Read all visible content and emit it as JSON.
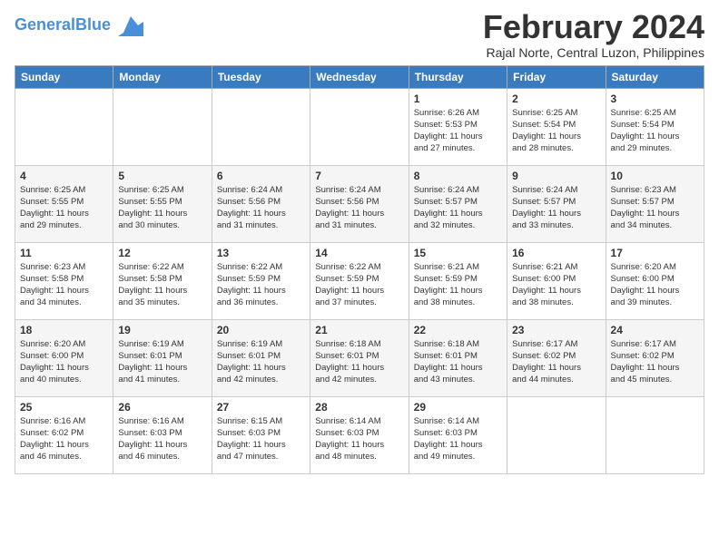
{
  "header": {
    "logo_line1": "General",
    "logo_line2": "Blue",
    "month_year": "February 2024",
    "location": "Rajal Norte, Central Luzon, Philippines"
  },
  "weekdays": [
    "Sunday",
    "Monday",
    "Tuesday",
    "Wednesday",
    "Thursday",
    "Friday",
    "Saturday"
  ],
  "weeks": [
    [
      {
        "day": "",
        "info": ""
      },
      {
        "day": "",
        "info": ""
      },
      {
        "day": "",
        "info": ""
      },
      {
        "day": "",
        "info": ""
      },
      {
        "day": "1",
        "info": "Sunrise: 6:26 AM\nSunset: 5:53 PM\nDaylight: 11 hours\nand 27 minutes."
      },
      {
        "day": "2",
        "info": "Sunrise: 6:25 AM\nSunset: 5:54 PM\nDaylight: 11 hours\nand 28 minutes."
      },
      {
        "day": "3",
        "info": "Sunrise: 6:25 AM\nSunset: 5:54 PM\nDaylight: 11 hours\nand 29 minutes."
      }
    ],
    [
      {
        "day": "4",
        "info": "Sunrise: 6:25 AM\nSunset: 5:55 PM\nDaylight: 11 hours\nand 29 minutes."
      },
      {
        "day": "5",
        "info": "Sunrise: 6:25 AM\nSunset: 5:55 PM\nDaylight: 11 hours\nand 30 minutes."
      },
      {
        "day": "6",
        "info": "Sunrise: 6:24 AM\nSunset: 5:56 PM\nDaylight: 11 hours\nand 31 minutes."
      },
      {
        "day": "7",
        "info": "Sunrise: 6:24 AM\nSunset: 5:56 PM\nDaylight: 11 hours\nand 31 minutes."
      },
      {
        "day": "8",
        "info": "Sunrise: 6:24 AM\nSunset: 5:57 PM\nDaylight: 11 hours\nand 32 minutes."
      },
      {
        "day": "9",
        "info": "Sunrise: 6:24 AM\nSunset: 5:57 PM\nDaylight: 11 hours\nand 33 minutes."
      },
      {
        "day": "10",
        "info": "Sunrise: 6:23 AM\nSunset: 5:57 PM\nDaylight: 11 hours\nand 34 minutes."
      }
    ],
    [
      {
        "day": "11",
        "info": "Sunrise: 6:23 AM\nSunset: 5:58 PM\nDaylight: 11 hours\nand 34 minutes."
      },
      {
        "day": "12",
        "info": "Sunrise: 6:22 AM\nSunset: 5:58 PM\nDaylight: 11 hours\nand 35 minutes."
      },
      {
        "day": "13",
        "info": "Sunrise: 6:22 AM\nSunset: 5:59 PM\nDaylight: 11 hours\nand 36 minutes."
      },
      {
        "day": "14",
        "info": "Sunrise: 6:22 AM\nSunset: 5:59 PM\nDaylight: 11 hours\nand 37 minutes."
      },
      {
        "day": "15",
        "info": "Sunrise: 6:21 AM\nSunset: 5:59 PM\nDaylight: 11 hours\nand 38 minutes."
      },
      {
        "day": "16",
        "info": "Sunrise: 6:21 AM\nSunset: 6:00 PM\nDaylight: 11 hours\nand 38 minutes."
      },
      {
        "day": "17",
        "info": "Sunrise: 6:20 AM\nSunset: 6:00 PM\nDaylight: 11 hours\nand 39 minutes."
      }
    ],
    [
      {
        "day": "18",
        "info": "Sunrise: 6:20 AM\nSunset: 6:00 PM\nDaylight: 11 hours\nand 40 minutes."
      },
      {
        "day": "19",
        "info": "Sunrise: 6:19 AM\nSunset: 6:01 PM\nDaylight: 11 hours\nand 41 minutes."
      },
      {
        "day": "20",
        "info": "Sunrise: 6:19 AM\nSunset: 6:01 PM\nDaylight: 11 hours\nand 42 minutes."
      },
      {
        "day": "21",
        "info": "Sunrise: 6:18 AM\nSunset: 6:01 PM\nDaylight: 11 hours\nand 42 minutes."
      },
      {
        "day": "22",
        "info": "Sunrise: 6:18 AM\nSunset: 6:01 PM\nDaylight: 11 hours\nand 43 minutes."
      },
      {
        "day": "23",
        "info": "Sunrise: 6:17 AM\nSunset: 6:02 PM\nDaylight: 11 hours\nand 44 minutes."
      },
      {
        "day": "24",
        "info": "Sunrise: 6:17 AM\nSunset: 6:02 PM\nDaylight: 11 hours\nand 45 minutes."
      }
    ],
    [
      {
        "day": "25",
        "info": "Sunrise: 6:16 AM\nSunset: 6:02 PM\nDaylight: 11 hours\nand 46 minutes."
      },
      {
        "day": "26",
        "info": "Sunrise: 6:16 AM\nSunset: 6:03 PM\nDaylight: 11 hours\nand 46 minutes."
      },
      {
        "day": "27",
        "info": "Sunrise: 6:15 AM\nSunset: 6:03 PM\nDaylight: 11 hours\nand 47 minutes."
      },
      {
        "day": "28",
        "info": "Sunrise: 6:14 AM\nSunset: 6:03 PM\nDaylight: 11 hours\nand 48 minutes."
      },
      {
        "day": "29",
        "info": "Sunrise: 6:14 AM\nSunset: 6:03 PM\nDaylight: 11 hours\nand 49 minutes."
      },
      {
        "day": "",
        "info": ""
      },
      {
        "day": "",
        "info": ""
      }
    ]
  ]
}
